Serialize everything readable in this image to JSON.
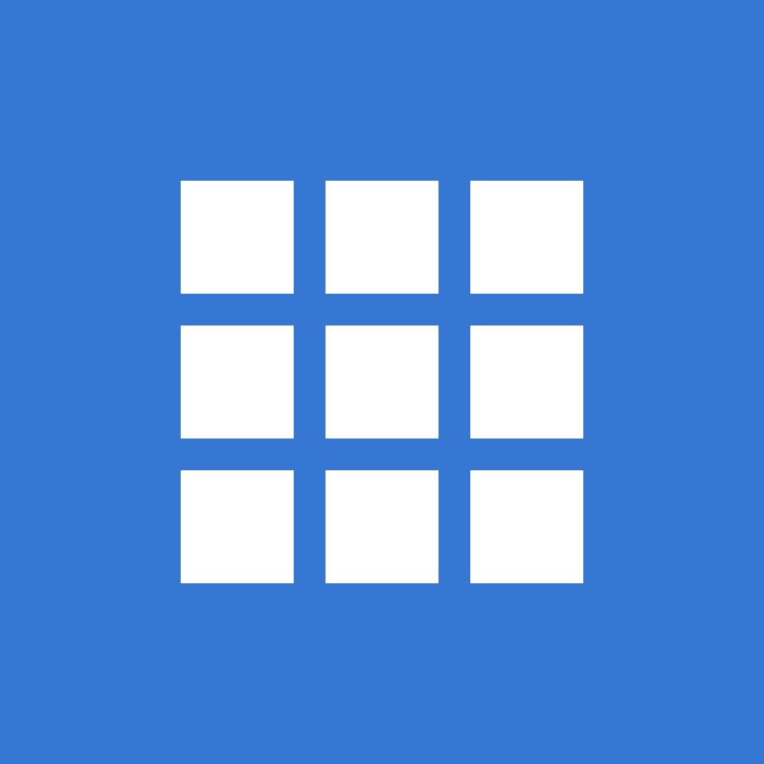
{
  "icon": {
    "name": "grid-icon",
    "rows": 3,
    "columns": 3
  },
  "colors": {
    "background": "#3577d3",
    "cell": "#ffffff"
  }
}
